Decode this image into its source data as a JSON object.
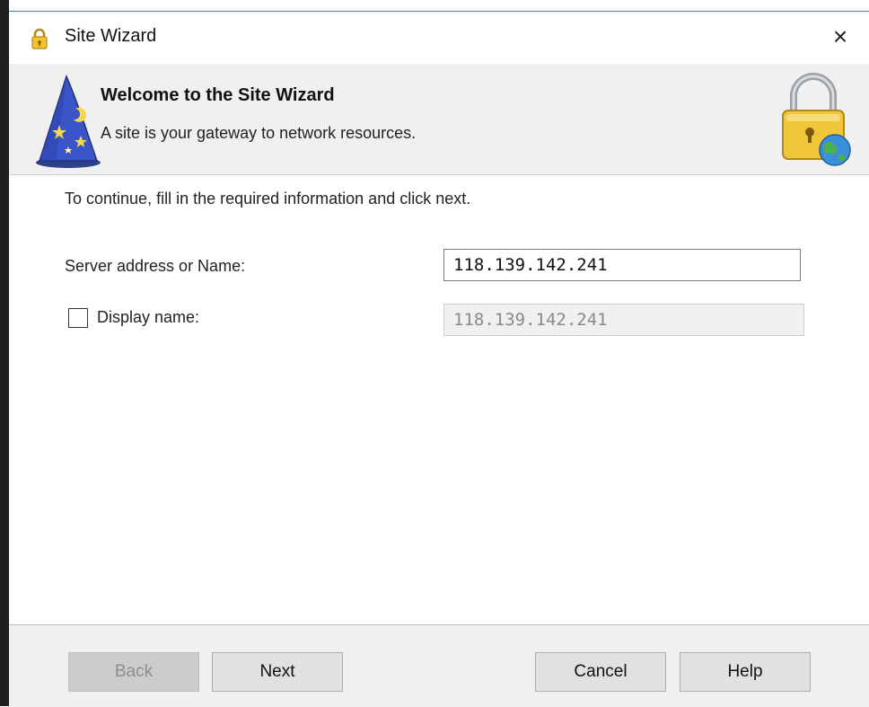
{
  "window": {
    "title": "Site Wizard",
    "close_label": "×"
  },
  "header": {
    "title": "Welcome to the Site Wizard",
    "subtitle": "A site is your gateway to network resources."
  },
  "content": {
    "instruction": "To continue, fill in the required information and click next.",
    "server": {
      "label": "Server address or Name:",
      "value": "118.139.142.241"
    },
    "display": {
      "label": "Display name:",
      "checked": false,
      "value": "118.139.142.241"
    }
  },
  "footer": {
    "back_label": "Back",
    "next_label": "Next",
    "cancel_label": "Cancel",
    "help_label": "Help"
  },
  "icons": {
    "title_icon": "lock-icon",
    "wizard_icon": "wizard-hat-icon",
    "header_icon": "lock-globe-icon"
  },
  "colors": {
    "accent": "#3c7fd6",
    "header_bg": "#f0f0f0",
    "footer_bg": "#f0f0f0",
    "disabled_button_bg": "#cccccc"
  }
}
